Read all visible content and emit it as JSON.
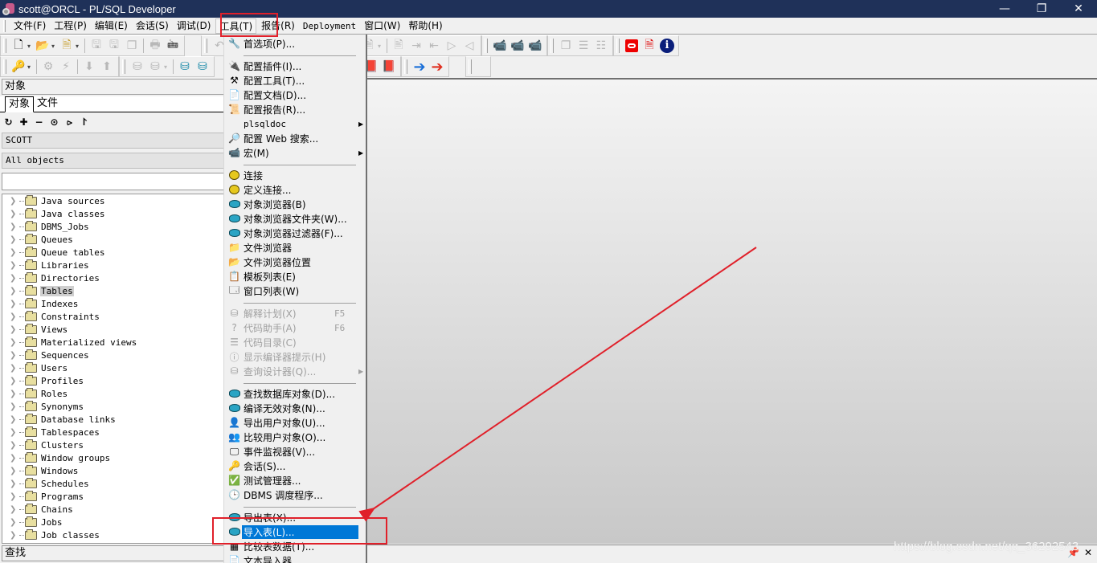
{
  "window": {
    "title": "scott@ORCL - PL/SQL Developer",
    "controls": [
      "minimize",
      "restore",
      "close"
    ]
  },
  "menubar": {
    "items": [
      {
        "label": "文件(F)"
      },
      {
        "label": "工程(P)"
      },
      {
        "label": "编辑(E)"
      },
      {
        "label": "会话(S)"
      },
      {
        "label": "调试(D)"
      },
      {
        "label": "工具(T)",
        "active": true
      },
      {
        "label": "报告(R)"
      },
      {
        "label": "Deployment"
      },
      {
        "label": "窗口(W)"
      },
      {
        "label": "帮助(H)"
      }
    ]
  },
  "left_panel": {
    "title": "对象",
    "tabs": [
      {
        "label": "对象",
        "active": true
      },
      {
        "label": "文件"
      }
    ],
    "user_combo": "SCOTT",
    "filter_combo": "All objects",
    "search_value": "",
    "tree_items": [
      {
        "label": "Java sources"
      },
      {
        "label": "Java classes"
      },
      {
        "label": "DBMS_Jobs"
      },
      {
        "label": "Queues"
      },
      {
        "label": "Queue tables"
      },
      {
        "label": "Libraries"
      },
      {
        "label": "Directories"
      },
      {
        "label": "Tables",
        "selected": true
      },
      {
        "label": "Indexes"
      },
      {
        "label": "Constraints"
      },
      {
        "label": "Views"
      },
      {
        "label": "Materialized views"
      },
      {
        "label": "Sequences"
      },
      {
        "label": "Users"
      },
      {
        "label": "Profiles"
      },
      {
        "label": "Roles"
      },
      {
        "label": "Synonyms"
      },
      {
        "label": "Database links"
      },
      {
        "label": "Tablespaces"
      },
      {
        "label": "Clusters"
      },
      {
        "label": "Window groups"
      },
      {
        "label": "Windows"
      },
      {
        "label": "Schedules"
      },
      {
        "label": "Programs"
      },
      {
        "label": "Chains"
      },
      {
        "label": "Jobs"
      },
      {
        "label": "Job classes"
      }
    ],
    "find_label": "查找"
  },
  "tools_menu": {
    "items": [
      {
        "label": "首选项(P)...",
        "icon": "wrench-icon"
      },
      {
        "separator": true
      },
      {
        "label": "配置插件(I)...",
        "icon": "plugin-config-icon"
      },
      {
        "label": "配置工具(T)...",
        "icon": "tools-config-icon"
      },
      {
        "label": "配置文档(D)...",
        "icon": "document-config-icon"
      },
      {
        "label": "配置报告(R)...",
        "icon": "report-config-icon"
      },
      {
        "label": "plsqldoc",
        "submenu": true,
        "mono": true
      },
      {
        "label": "配置 Web 搜索...",
        "icon": "web-search-icon"
      },
      {
        "label": "宏(M)",
        "icon": "macro-icon",
        "submenu": true
      },
      {
        "separator": true
      },
      {
        "label": "连接",
        "icon": "connection-icon"
      },
      {
        "label": "定义连接...",
        "icon": "define-connection-icon"
      },
      {
        "label": "对象浏览器(B)",
        "icon": "object-browser-icon"
      },
      {
        "label": "对象浏览器文件夹(W)...",
        "icon": "object-browser-folders-icon"
      },
      {
        "label": "对象浏览器过滤器(F)...",
        "icon": "object-browser-filter-icon"
      },
      {
        "label": "文件浏览器",
        "icon": "file-browser-icon"
      },
      {
        "label": "文件浏览器位置",
        "icon": "file-browser-locations-icon"
      },
      {
        "label": "模板列表(E)",
        "icon": "template-list-icon"
      },
      {
        "label": "窗口列表(W)",
        "icon": "window-list-icon"
      },
      {
        "separator": true
      },
      {
        "label": "解释计划(X)",
        "icon": "explain-plan-icon",
        "shortcut": "F5",
        "disabled": true
      },
      {
        "label": "代码助手(A)",
        "icon": "code-assistant-icon",
        "shortcut": "F6",
        "disabled": true
      },
      {
        "label": "代码目录(C)",
        "icon": "code-contents-icon",
        "disabled": true
      },
      {
        "label": "显示编译器提示(H)",
        "icon": "compiler-hints-icon",
        "disabled": true
      },
      {
        "label": "查询设计器(Q)...",
        "icon": "query-builder-icon",
        "disabled": true,
        "submenu": true
      },
      {
        "separator": true
      },
      {
        "label": "查找数据库对象(D)...",
        "icon": "find-db-objects-icon"
      },
      {
        "label": "编译无效对象(N)...",
        "icon": "compile-invalid-icon"
      },
      {
        "label": "导出用户对象(U)...",
        "icon": "export-user-objects-icon"
      },
      {
        "label": "比较用户对象(O)...",
        "icon": "compare-user-objects-icon"
      },
      {
        "label": "事件监视器(V)...",
        "icon": "event-monitor-icon"
      },
      {
        "label": "会话(S)...",
        "icon": "sessions-icon"
      },
      {
        "label": "测试管理器...",
        "icon": "test-manager-icon"
      },
      {
        "label": "DBMS 调度程序...",
        "icon": "dbms-scheduler-icon"
      },
      {
        "separator": true
      },
      {
        "label": "导出表(X)...",
        "icon": "export-tables-icon"
      },
      {
        "label": "导入表(L)...",
        "icon": "import-tables-icon",
        "highlight": true
      },
      {
        "label": "比较表数据(T)...",
        "icon": "compare-table-data-icon"
      },
      {
        "label": "文本导入器...",
        "icon": "text-importer-icon"
      }
    ]
  },
  "watermark": "https://blog.csdn.net/qq_36292543",
  "annotations": {
    "color": "#e0202a"
  },
  "colors": {
    "titlebar": "#1f3159",
    "highlight": "#0078d7"
  }
}
